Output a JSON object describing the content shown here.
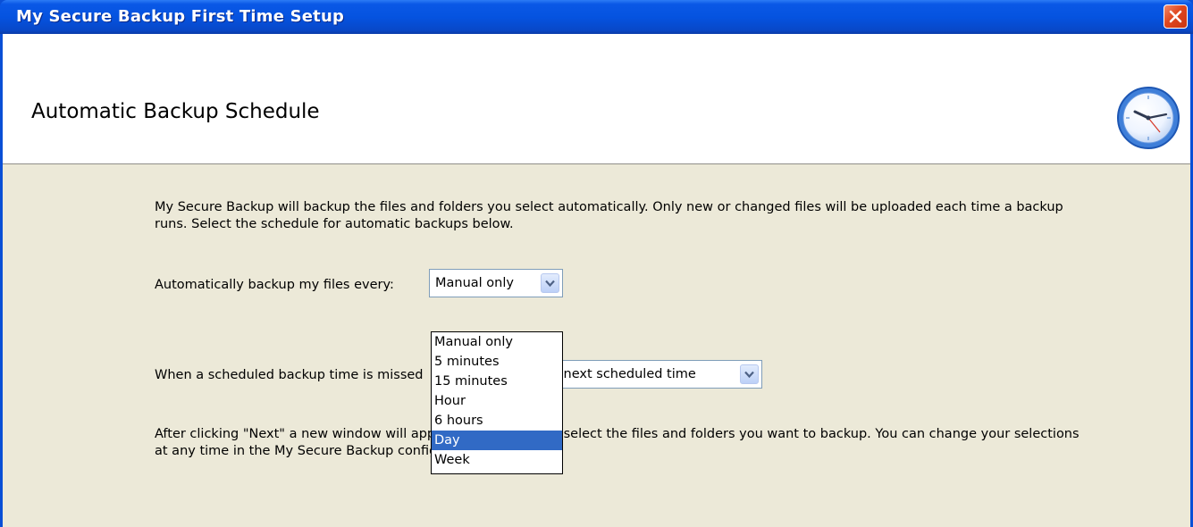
{
  "window": {
    "title": "My Secure Backup First Time Setup"
  },
  "header": {
    "title": "Automatic Backup Schedule"
  },
  "content": {
    "intro": "My Secure Backup will backup the files and folders you select automatically. Only new or changed files will be uploaded each time a backup runs. Select the schedule for automatic backups below.",
    "every_label": "Automatically backup my files every:",
    "every_value": "Manual only",
    "missed_label": "When a scheduled backup time is missed",
    "missed_value": "e next scheduled time",
    "after_text": "After clicking \"Next\" a new window will appear allowing you to select the files and folders you want to backup. You can change your selections at any time in the My Secure Backup configuration dialog."
  },
  "dropdown": {
    "options": [
      "Manual only",
      "5 minutes",
      "15 minutes",
      "Hour",
      "6 hours",
      "Day",
      "Week"
    ],
    "highlighted": "Day"
  },
  "icons": {
    "close": "close-icon",
    "clock": "clock-icon",
    "combo_arrow": "chevron-down-icon"
  },
  "colors": {
    "titlebar": "#0553e0",
    "selection": "#316ac5",
    "dialog_bg": "#ece9d8"
  }
}
